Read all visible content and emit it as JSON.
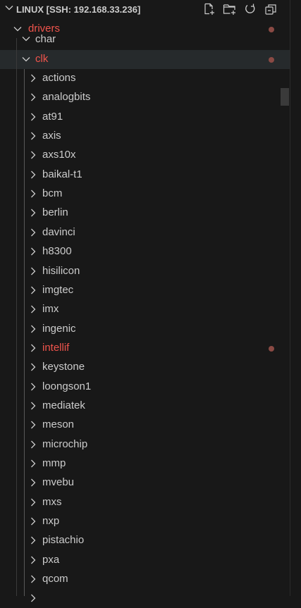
{
  "explorer": {
    "title": "LINUX [SSH: 192.168.33.236]",
    "actions": [
      "New File",
      "New Folder",
      "Refresh Explorer",
      "Collapse Folders in Explorer"
    ]
  },
  "tree": {
    "drivers": "drivers",
    "char": "char",
    "clk": "clk",
    "children": [
      {
        "label": "actions"
      },
      {
        "label": "analogbits"
      },
      {
        "label": "at91"
      },
      {
        "label": "axis"
      },
      {
        "label": "axs10x"
      },
      {
        "label": "baikal-t1"
      },
      {
        "label": "bcm"
      },
      {
        "label": "berlin"
      },
      {
        "label": "davinci"
      },
      {
        "label": "h8300"
      },
      {
        "label": "hisilicon"
      },
      {
        "label": "imgtec"
      },
      {
        "label": "imx"
      },
      {
        "label": "ingenic"
      },
      {
        "label": "intellif",
        "modified": true
      },
      {
        "label": "keystone"
      },
      {
        "label": "loongson1"
      },
      {
        "label": "mediatek"
      },
      {
        "label": "meson"
      },
      {
        "label": "microchip"
      },
      {
        "label": "mmp"
      },
      {
        "label": "mvebu"
      },
      {
        "label": "mxs"
      },
      {
        "label": "nxp"
      },
      {
        "label": "pistachio"
      },
      {
        "label": "pxa"
      },
      {
        "label": "qcom"
      },
      {
        "label": ""
      }
    ]
  },
  "colors": {
    "modified": "#f0544c",
    "dot": "#8a4a44",
    "background": "#181818"
  }
}
